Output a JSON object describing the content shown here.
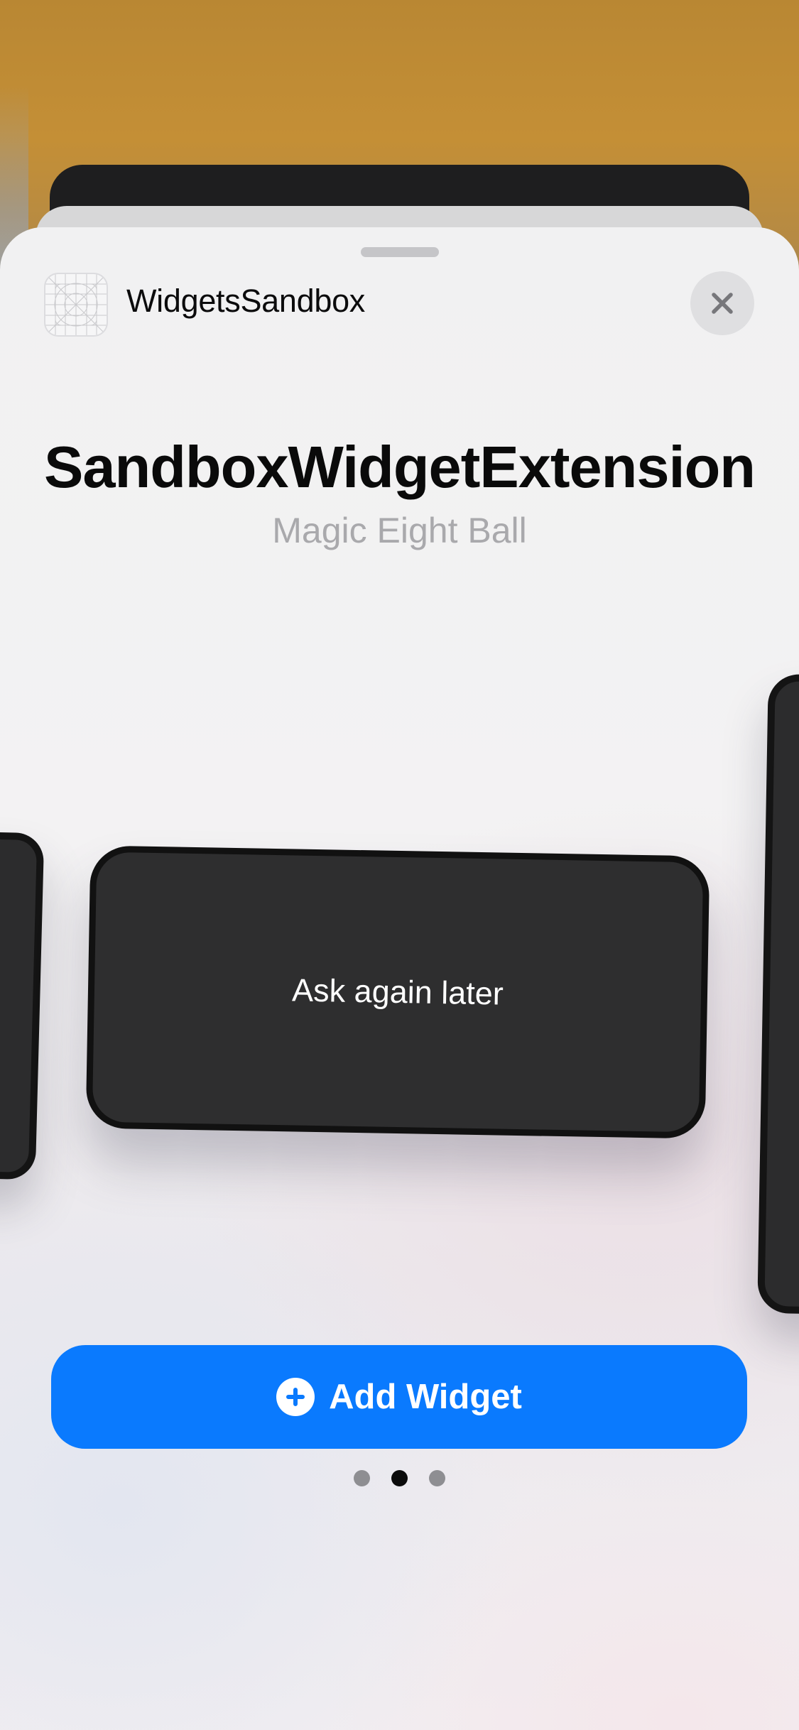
{
  "header": {
    "app_name": "WidgetsSandbox",
    "app_icon": "app-icon-placeholder-grid",
    "close_icon": "xmark-icon"
  },
  "widget": {
    "title": "SandboxWidgetExtension",
    "subtitle": "Magic Eight Ball",
    "preview_text": "Ask again later"
  },
  "pagination": {
    "pages": 3,
    "current_page": 2
  },
  "footer": {
    "add_button_label": "Add Widget",
    "add_button_icon": "plus-circle-icon"
  },
  "colors": {
    "accent": "#0a7afe",
    "widget_background": "#2e2e2f"
  }
}
